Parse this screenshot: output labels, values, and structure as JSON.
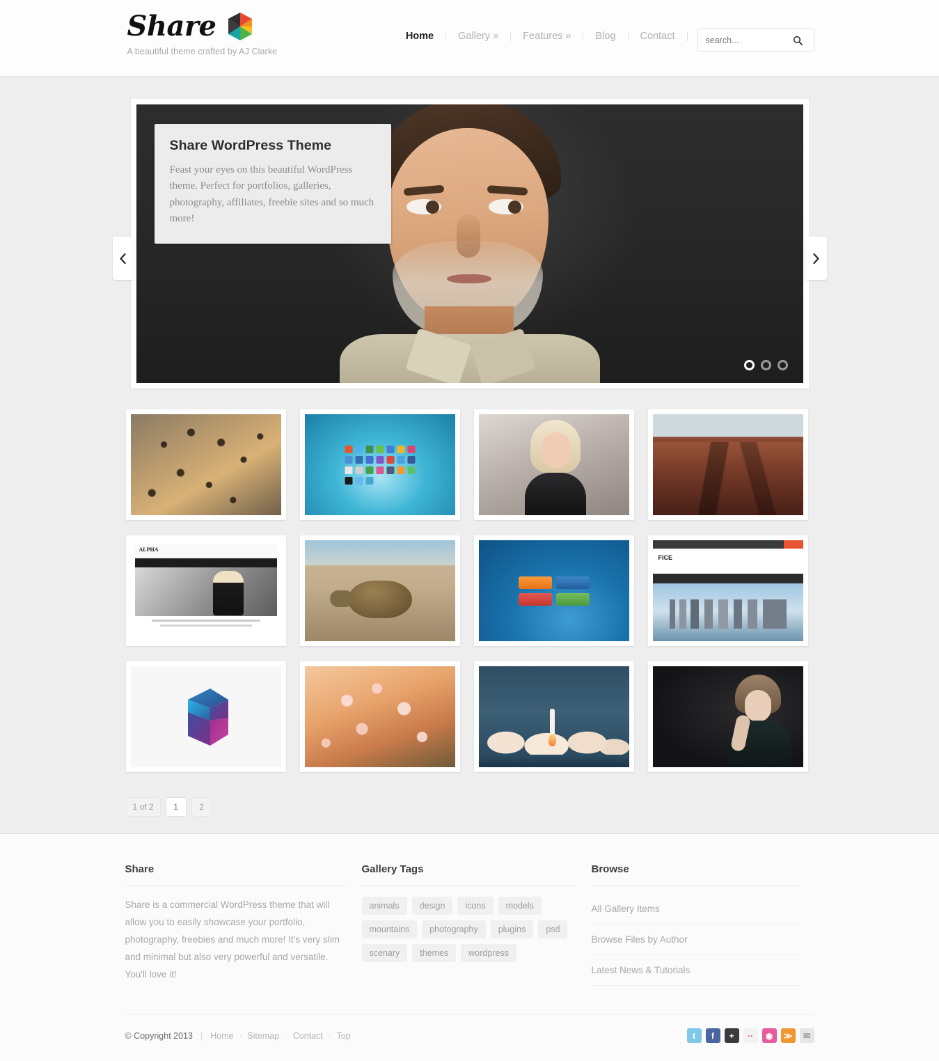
{
  "header": {
    "logo_text": "Share",
    "logo_icon": "hexagon-pinwheel-icon",
    "tagline": "A beautiful theme crafted by AJ Clarke",
    "nav": [
      {
        "label": "Home",
        "active": true
      },
      {
        "label": "Gallery »",
        "active": false
      },
      {
        "label": "Features »",
        "active": false
      },
      {
        "label": "Blog",
        "active": false
      },
      {
        "label": "Contact",
        "active": false
      }
    ],
    "search": {
      "placeholder": "search...",
      "value": "",
      "icon": "search-icon"
    }
  },
  "slider": {
    "caption": {
      "title": "Share WordPress Theme",
      "text": "Feast your eyes on this beautiful WordPress theme. Perfect for portfolios, galleries, photography, affiliates, freebie sites and so much more!"
    },
    "prev_icon": "chevron-left-icon",
    "next_icon": "chevron-right-icon",
    "dots": 3,
    "active_dot": 1,
    "slide_alt": "Man with white beard looking up on dark grey background"
  },
  "gallery": {
    "items": [
      {
        "name": "leopard-photo",
        "art": "art-leopard",
        "alt": "Leopard resting on rock"
      },
      {
        "name": "social-icons-set",
        "art": "art-icons",
        "alt": "Colorful social media icon set on blue gradient"
      },
      {
        "name": "blonde-model-photo",
        "art": "art-blonde",
        "alt": "Blonde model portrait"
      },
      {
        "name": "canyon-photo",
        "art": "art-canyon",
        "alt": "Red rock canyon landscape"
      },
      {
        "name": "alpha-theme-screenshot",
        "art": "art-alpha",
        "alt": "ALPHA WordPress theme screenshot"
      },
      {
        "name": "tortoise-photo",
        "art": "art-turtle",
        "alt": "Tortoise walking on sand"
      },
      {
        "name": "buttons-psd",
        "art": "art-buttons",
        "alt": "Set of four colored buttons on blue background"
      },
      {
        "name": "fice-theme-screenshot",
        "art": "art-fice",
        "alt": "FICE WordPress theme screenshot with city skyline"
      },
      {
        "name": "s-logo-design",
        "art": "art-slogo",
        "alt": "Gradient geometric S logo"
      },
      {
        "name": "blossom-photo",
        "art": "art-blossom",
        "alt": "Cherry blossom branches"
      },
      {
        "name": "shuttle-launch-photo",
        "art": "art-shuttle",
        "alt": "Space shuttle launch with smoke clouds"
      },
      {
        "name": "brunette-model-photo",
        "art": "art-brunette",
        "alt": "Brunette model portrait on dark background"
      }
    ],
    "icon_colors": [
      "#e8542f",
      "#49b4e8",
      "#3f8f4e",
      "#6cc04a",
      "#3f7fd1",
      "#f0b429",
      "#e0456b",
      "#4a90d9",
      "#2f6fb0",
      "#3f6fcf",
      "#8354c9",
      "#d8493f",
      "#4aa3e0",
      "#3b5998",
      "#e8e8e8",
      "#cfcfcf",
      "#47a04a",
      "#e0568f",
      "#4b5f7a",
      "#f29a2e",
      "#5ec06a",
      "#1a1a1a",
      "#66b8ef",
      "#45a9cf"
    ],
    "button_colors": [
      "#ef8023",
      "#2a6fb5",
      "#d6463f",
      "#5aa845"
    ]
  },
  "pagination": {
    "summary": "1 of 2",
    "pages": [
      {
        "label": "1",
        "current": true
      },
      {
        "label": "2",
        "current": false
      }
    ]
  },
  "footer": {
    "col1": {
      "title": "Share",
      "text": "Share is a commercial WordPress theme that will allow you to easily showcase your portfolio, photography, freebies and much more! It's very slim and minimal but also very powerful and versatile. You'll love it!"
    },
    "col2": {
      "title": "Gallery Tags",
      "tags": [
        "animals",
        "design",
        "icons",
        "models",
        "mountains",
        "photography",
        "plugins",
        "psd",
        "scenary",
        "themes",
        "wordpress"
      ]
    },
    "col3": {
      "title": "Browse",
      "links": [
        "All Gallery Items",
        "Browse Files by Author",
        "Latest News & Tutorials"
      ]
    },
    "copyright": "© Copyright 2013",
    "copy_links": [
      "Home",
      "Sitemap",
      "Contact",
      "Top"
    ],
    "social": [
      {
        "name": "twitter-icon",
        "glyph": "t",
        "color": "#7fc8e8"
      },
      {
        "name": "facebook-icon",
        "glyph": "f",
        "color": "#4a66a0"
      },
      {
        "name": "google-plus-icon",
        "glyph": "+",
        "color": "#3b3b3b"
      },
      {
        "name": "flickr-icon",
        "glyph": "··",
        "color": "#f2f2f2"
      },
      {
        "name": "dribbble-icon",
        "glyph": "◉",
        "color": "#e55b9c"
      },
      {
        "name": "rss-icon",
        "glyph": "≫",
        "color": "#f2962e"
      },
      {
        "name": "email-icon",
        "glyph": "✉",
        "color": "#e6e6e6"
      }
    ]
  }
}
